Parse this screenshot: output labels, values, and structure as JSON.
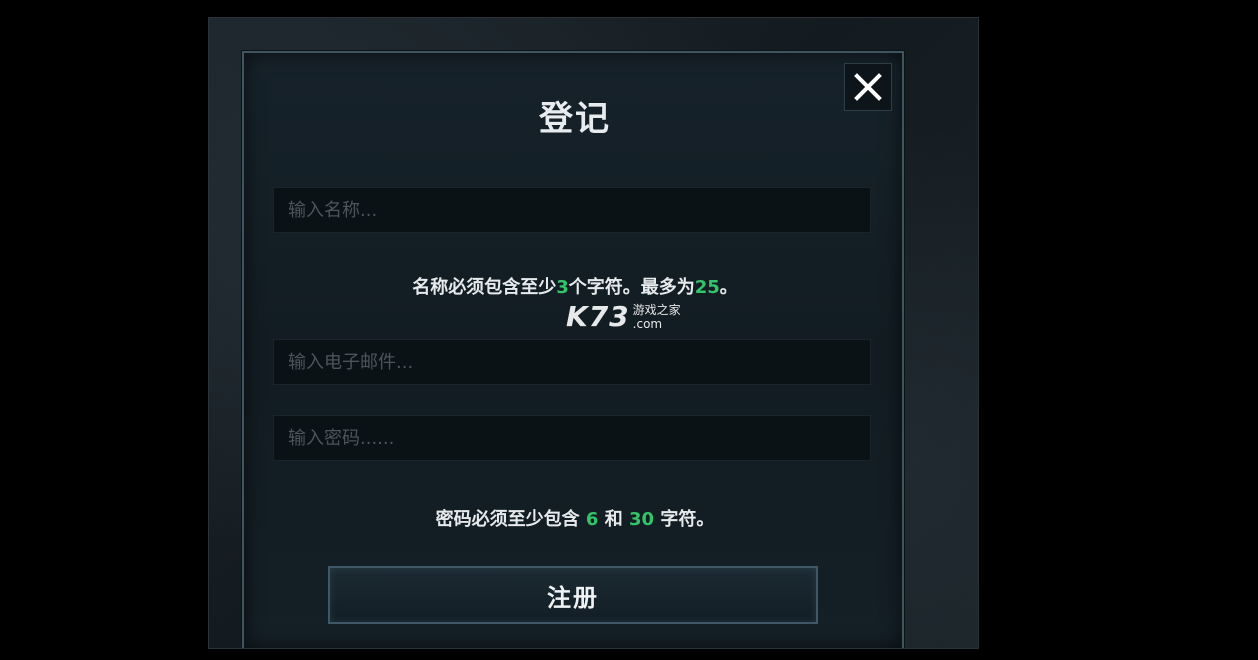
{
  "dialog": {
    "title": "登记",
    "close_icon": "close-icon"
  },
  "form": {
    "name_placeholder": "输入名称...",
    "email_placeholder": "输入电子邮件...",
    "password_placeholder": "输入密码......",
    "name_rule": {
      "prefix": "名称必须包含至少",
      "min": "3",
      "middle": "个字符。最多为",
      "max": "25",
      "suffix": "。"
    },
    "password_rule": {
      "prefix": "密码必须至少包含 ",
      "min": "6",
      "middle": " 和 ",
      "max": "30",
      "suffix": " 字符。"
    },
    "register_label": "注册"
  },
  "watermark": {
    "logo": "K73",
    "site_name": "游戏之家",
    "domain": ".com"
  },
  "colors": {
    "accent_number": "#33c46a",
    "panel_border": "#3f5560"
  }
}
